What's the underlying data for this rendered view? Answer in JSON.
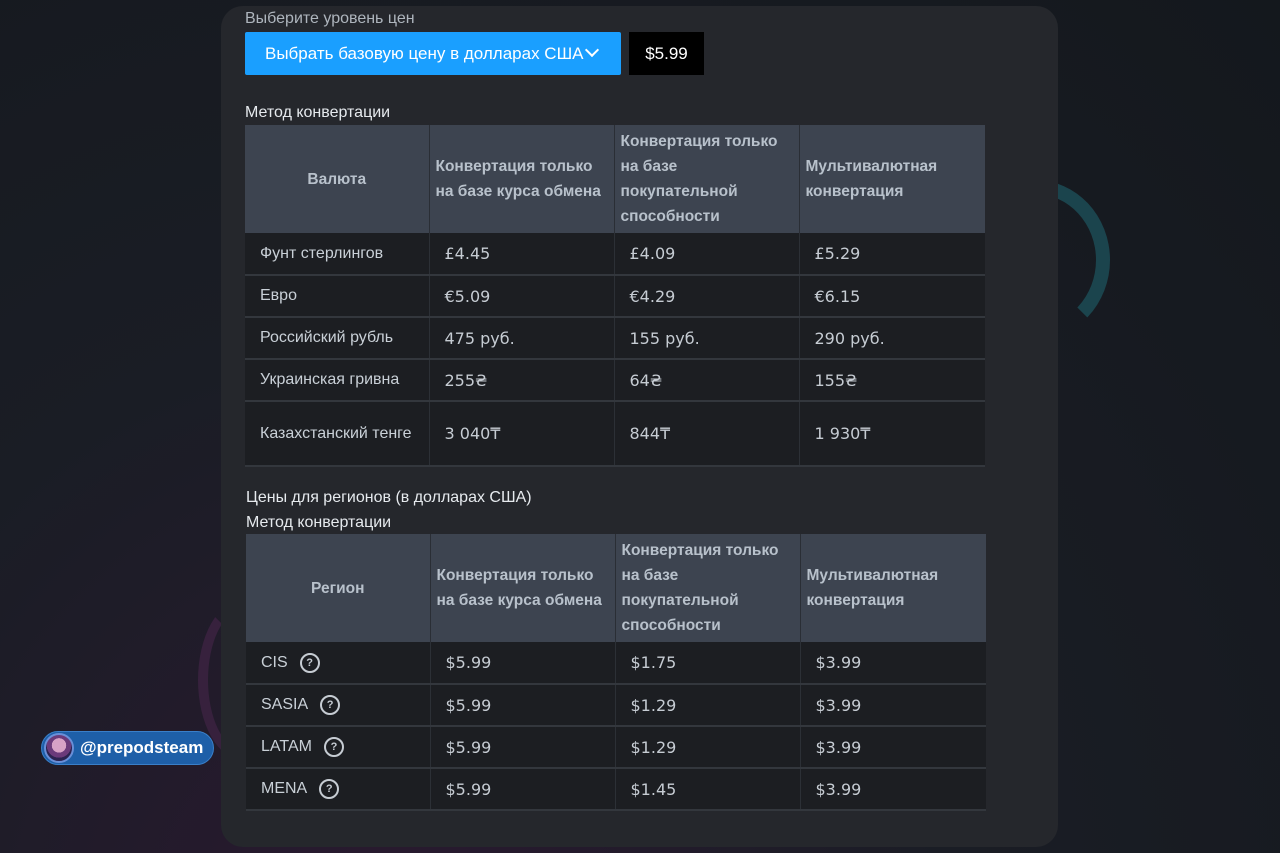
{
  "price_level": {
    "label": "Выберите уровень цен",
    "select_label": "Выбрать базовую цену в долларах США",
    "price": "$5.99"
  },
  "currency_table": {
    "title": "Метод конвертации",
    "headers": [
      "Валюта",
      "Конвертация только на базе курса обмена",
      "Конвертация только на базе покупательной способности",
      "Мультивалютная конвертация"
    ],
    "rows": [
      [
        "Фунт стерлингов",
        "£4.45",
        "£4.09",
        "£5.29"
      ],
      [
        "Евро",
        "€5.09",
        "€4.29",
        "€6.15"
      ],
      [
        "Российский рубль",
        "475 руб.",
        "155 руб.",
        "290 руб."
      ],
      [
        "Украинская гривна",
        "255₴",
        "64₴",
        "155₴"
      ],
      [
        "Казахстанский тенге",
        "3 040₸",
        "844₸",
        "1 930₸"
      ]
    ]
  },
  "region_table": {
    "heading": "Цены для регионов (в долларах США)",
    "title": "Метод конвертации",
    "headers": [
      "Регион",
      "Конвертация только на базе курса обмена",
      "Конвертация только на базе покупательной способности",
      "Мультивалютная конвертация"
    ],
    "help_icon": "?",
    "rows": [
      [
        "CIS",
        "$5.99",
        "$1.75",
        "$3.99"
      ],
      [
        "SASIA",
        "$5.99",
        "$1.29",
        "$3.99"
      ],
      [
        "LATAM",
        "$5.99",
        "$1.29",
        "$3.99"
      ],
      [
        "MENA",
        "$5.99",
        "$1.45",
        "$3.99"
      ]
    ]
  },
  "watermark": {
    "handle": "@prepodsteam"
  },
  "colors": {
    "accent": "#1a9fff",
    "header_bg": "#3d4450",
    "row_bg": "#1c1e22",
    "card_bg": "#25272c"
  }
}
